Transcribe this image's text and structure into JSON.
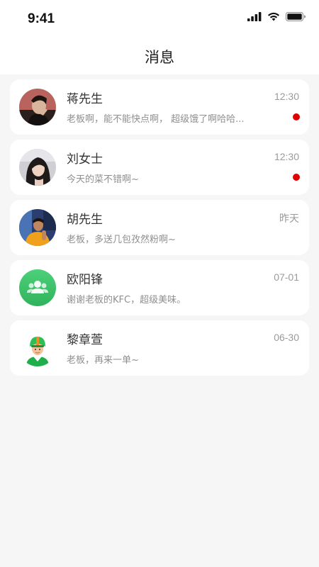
{
  "status_bar": {
    "time": "9:41",
    "icons": [
      "cellular-signal-icon",
      "wifi-icon",
      "battery-icon"
    ]
  },
  "header": {
    "title": "消息"
  },
  "colors": {
    "unread": "#e00000",
    "group_avatar": "#3cc36a",
    "rider_avatar": "#1fae4a"
  },
  "conversations": [
    {
      "name": "蒋先生",
      "time": "12:30",
      "preview": "老板啊，能不能快点啊， 超级饿了啊哈哈...",
      "unread": true,
      "avatar": "user-photo"
    },
    {
      "name": "刘女士",
      "time": "12:30",
      "preview": "今天的菜不错啊~",
      "unread": true,
      "avatar": "user-photo"
    },
    {
      "name": "胡先生",
      "time": "昨天",
      "preview": "老板，多送几包孜然粉啊~",
      "unread": false,
      "avatar": "user-photo"
    },
    {
      "name": "欧阳锋",
      "time": "07-01",
      "preview": "谢谢老板的KFC，超级美味。",
      "unread": false,
      "avatar": "group-icon"
    },
    {
      "name": "黎章萱",
      "time": "06-30",
      "preview": "老板，再来一单~",
      "unread": false,
      "avatar": "rider-icon"
    }
  ]
}
